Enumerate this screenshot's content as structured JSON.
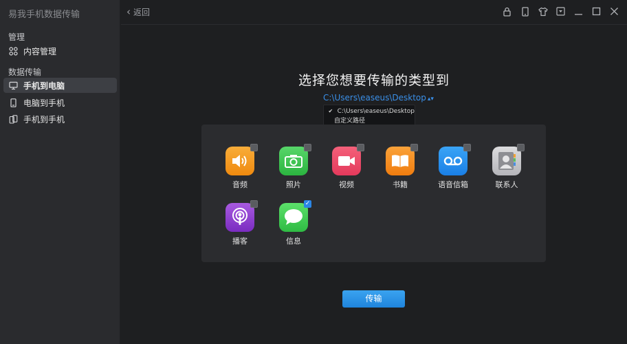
{
  "app": {
    "title": "易我手机数据传输"
  },
  "sidebar": {
    "section_manage": "管理",
    "manage_items": [
      {
        "label": "内容管理",
        "icon": "grid-icon"
      }
    ],
    "section_transfer": "数据传输",
    "transfer_items": [
      {
        "label": "手机到电脑",
        "icon": "monitor-icon",
        "active": true
      },
      {
        "label": "电脑到手机",
        "icon": "phone-icon"
      },
      {
        "label": "手机到手机",
        "icon": "phones-icon"
      }
    ]
  },
  "topbar": {
    "back_label": "返回",
    "icons": [
      "lock-icon",
      "phone-icon",
      "shirt-icon",
      "menu-dropdown-icon",
      "minimize-icon",
      "maximize-icon",
      "close-icon"
    ]
  },
  "main": {
    "heading": "选择您想要传输的类型到",
    "path": "C:\\Users\\easeus\\Desktop",
    "dropdown": {
      "options": [
        "C:\\Users\\easeus\\Desktop",
        "自定义路径"
      ],
      "selected": "C:\\Users\\easeus\\Desktop"
    },
    "types": [
      {
        "label": "音频",
        "icon": "speaker-icon",
        "color": "#f39a1e",
        "checked": false
      },
      {
        "label": "照片",
        "icon": "camera-icon",
        "color": "#35c04c",
        "checked": false
      },
      {
        "label": "视频",
        "icon": "video-camera-icon",
        "color": "#ee4a6a",
        "checked": false
      },
      {
        "label": "书籍",
        "icon": "book-icon",
        "color": "#f58a18",
        "checked": false
      },
      {
        "label": "语音信箱",
        "icon": "voicemail-icon",
        "color": "#1f8ef0",
        "checked": false
      },
      {
        "label": "联系人",
        "icon": "contacts-icon",
        "color": "#c8c8cc",
        "checked": false
      },
      {
        "label": "播客",
        "icon": "podcast-icon",
        "color": "#8e3fcf",
        "checked": false
      },
      {
        "label": "信息",
        "icon": "message-bubble-icon",
        "color": "#3ccf4e",
        "checked": true
      }
    ],
    "transfer_button": "传输"
  }
}
